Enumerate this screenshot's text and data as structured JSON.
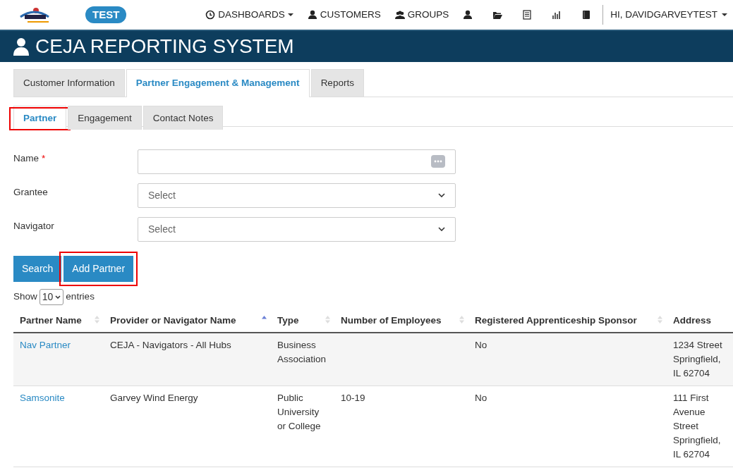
{
  "topbar": {
    "badge": "TEST",
    "menu": [
      {
        "kind": "dashboard",
        "label": "DASHBOARDS",
        "dropdown": true
      },
      {
        "kind": "person",
        "label": "CUSTOMERS",
        "dropdown": false
      },
      {
        "kind": "group",
        "label": "GROUPS",
        "dropdown": false
      },
      {
        "kind": "person",
        "dropdown": false
      },
      {
        "kind": "folder",
        "dropdown": false
      },
      {
        "kind": "report",
        "dropdown": false
      },
      {
        "kind": "chart",
        "dropdown": false
      },
      {
        "kind": "book",
        "dropdown": false
      }
    ],
    "user": "HI, DAVIDGARVEYTEST"
  },
  "banner": {
    "title": "CEJA REPORTING SYSTEM"
  },
  "tabs": [
    {
      "label": "Customer Information",
      "selected": false
    },
    {
      "label": "Partner Engagement & Management",
      "selected": true
    },
    {
      "label": "Reports",
      "selected": false
    }
  ],
  "subtabs": [
    {
      "label": "Partner",
      "selected": true,
      "highlighted": true
    },
    {
      "label": "Engagement",
      "selected": false,
      "highlighted": false
    },
    {
      "label": "Contact Notes",
      "selected": false,
      "highlighted": false
    }
  ],
  "form": {
    "fields": [
      {
        "label": "Name",
        "required_mark": "*",
        "kind": "text"
      },
      {
        "label": "Grantee",
        "kind": "select",
        "placeholder": "Select"
      },
      {
        "label": "Navigator",
        "kind": "select",
        "placeholder": "Select"
      }
    ],
    "buttons": [
      {
        "label": "Search",
        "highlighted": false
      },
      {
        "label": "Add Partner",
        "highlighted": true
      }
    ]
  },
  "entries": {
    "before": "Show",
    "value": "10",
    "after": "entries"
  },
  "table": {
    "columns": [
      {
        "label": "Partner Name",
        "sorted": false
      },
      {
        "label": "Provider or Navigator Name",
        "sorted": true
      },
      {
        "label": "Type",
        "sorted": false
      },
      {
        "label": "Number of Employees",
        "sorted": false
      },
      {
        "label": "Registered Apprenticeship Sponsor",
        "sorted": false
      },
      {
        "label": "Address"
      }
    ],
    "rows": [
      {
        "cells": [
          "Nav Partner",
          "CEJA - Navigators - All Hubs",
          "Business Association",
          "",
          "No",
          "1234 Street Springfield, IL 62704"
        ]
      },
      {
        "cells": [
          "Samsonite",
          "Garvey Wind Energy",
          "Public University or College",
          "10-19",
          "No",
          "111 First Avenue Street Springfield, IL 62704"
        ]
      }
    ]
  }
}
